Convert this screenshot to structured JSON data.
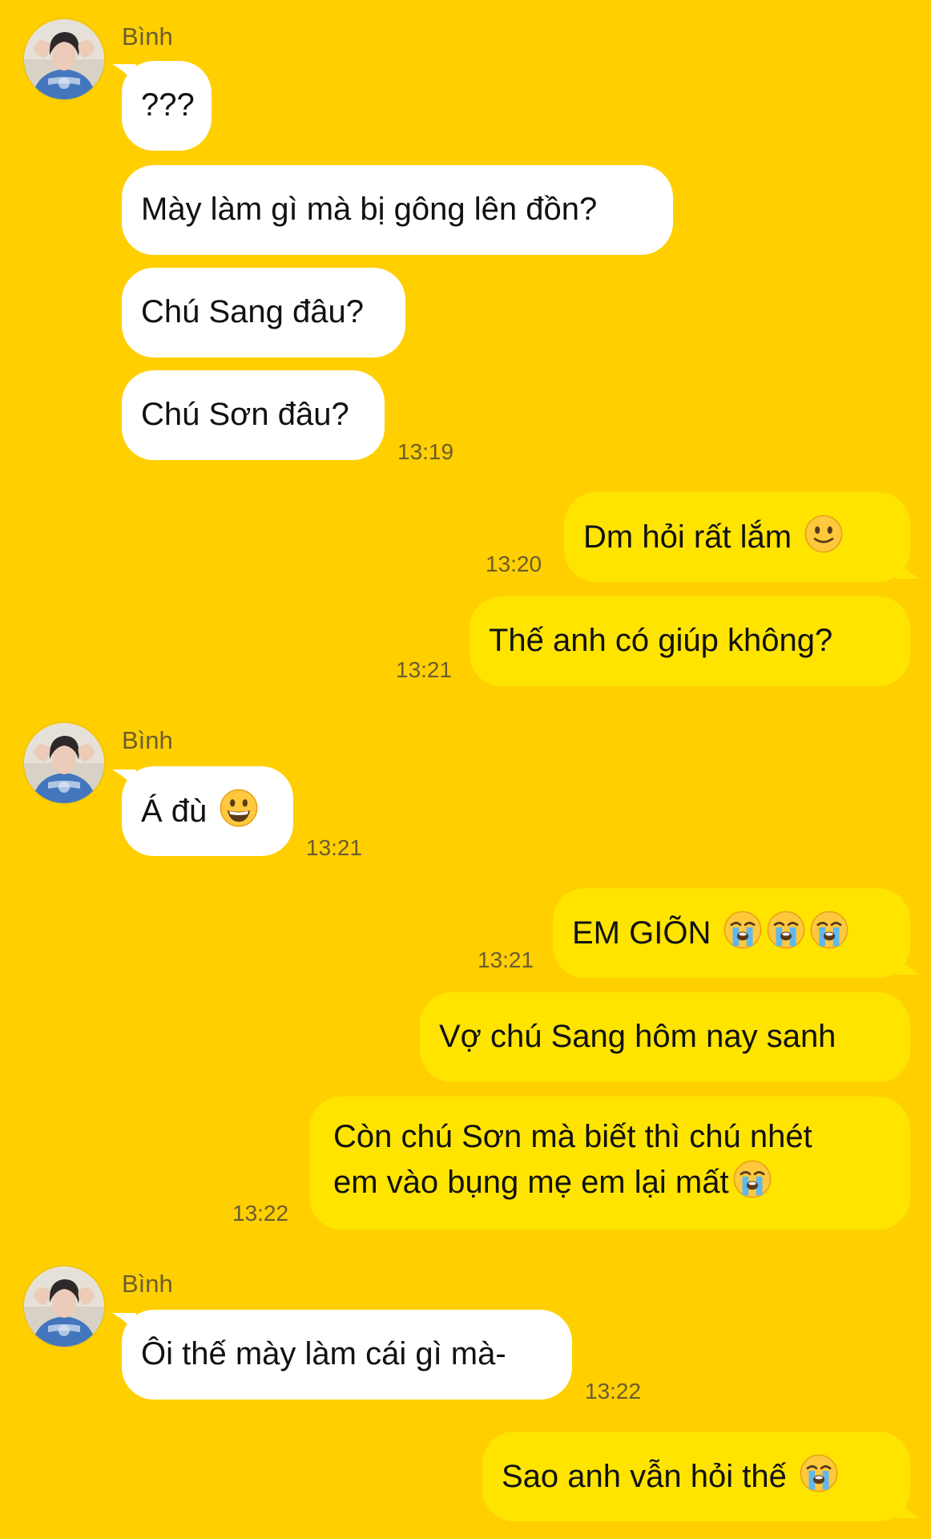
{
  "contact": {
    "name": "Bình"
  },
  "messages": [
    {
      "text": "???"
    },
    {
      "text": "Mày làm gì mà bị gông lên đồn?"
    },
    {
      "text": "Chú Sang đâu?"
    },
    {
      "text": "Chú Sơn đâu?",
      "time": "13:19"
    },
    {
      "text": "Dm hỏi rất lắm",
      "emoji": "slightly-smiling-face",
      "time": "13:20"
    },
    {
      "text": "Thế anh có giúp không?",
      "time": "13:21"
    },
    {
      "text": "Á đù",
      "emoji": "grinning-face",
      "time": "13:21"
    },
    {
      "text": "EM GIÕN",
      "emoji": "crying-face x3",
      "time": "13:21"
    },
    {
      "text": "Vợ chú Sang hôm nay sanh"
    },
    {
      "line1": "Còn chú Sơn mà biết thì chú nhét",
      "line2": "em vào bụng mẹ em lại mất",
      "emoji": "crying-face",
      "time": "13:22"
    },
    {
      "text": "Ôi thế mày làm cái gì mà-",
      "time": "13:22"
    },
    {
      "text": "Sao anh vẫn hỏi thế",
      "emoji": "crying-face"
    }
  ],
  "colors": {
    "background": "#FFCF00",
    "incoming_bubble": "#FFFFFF",
    "outgoing_bubble": "#FFE400",
    "meta_text": "#6b5d2e"
  }
}
